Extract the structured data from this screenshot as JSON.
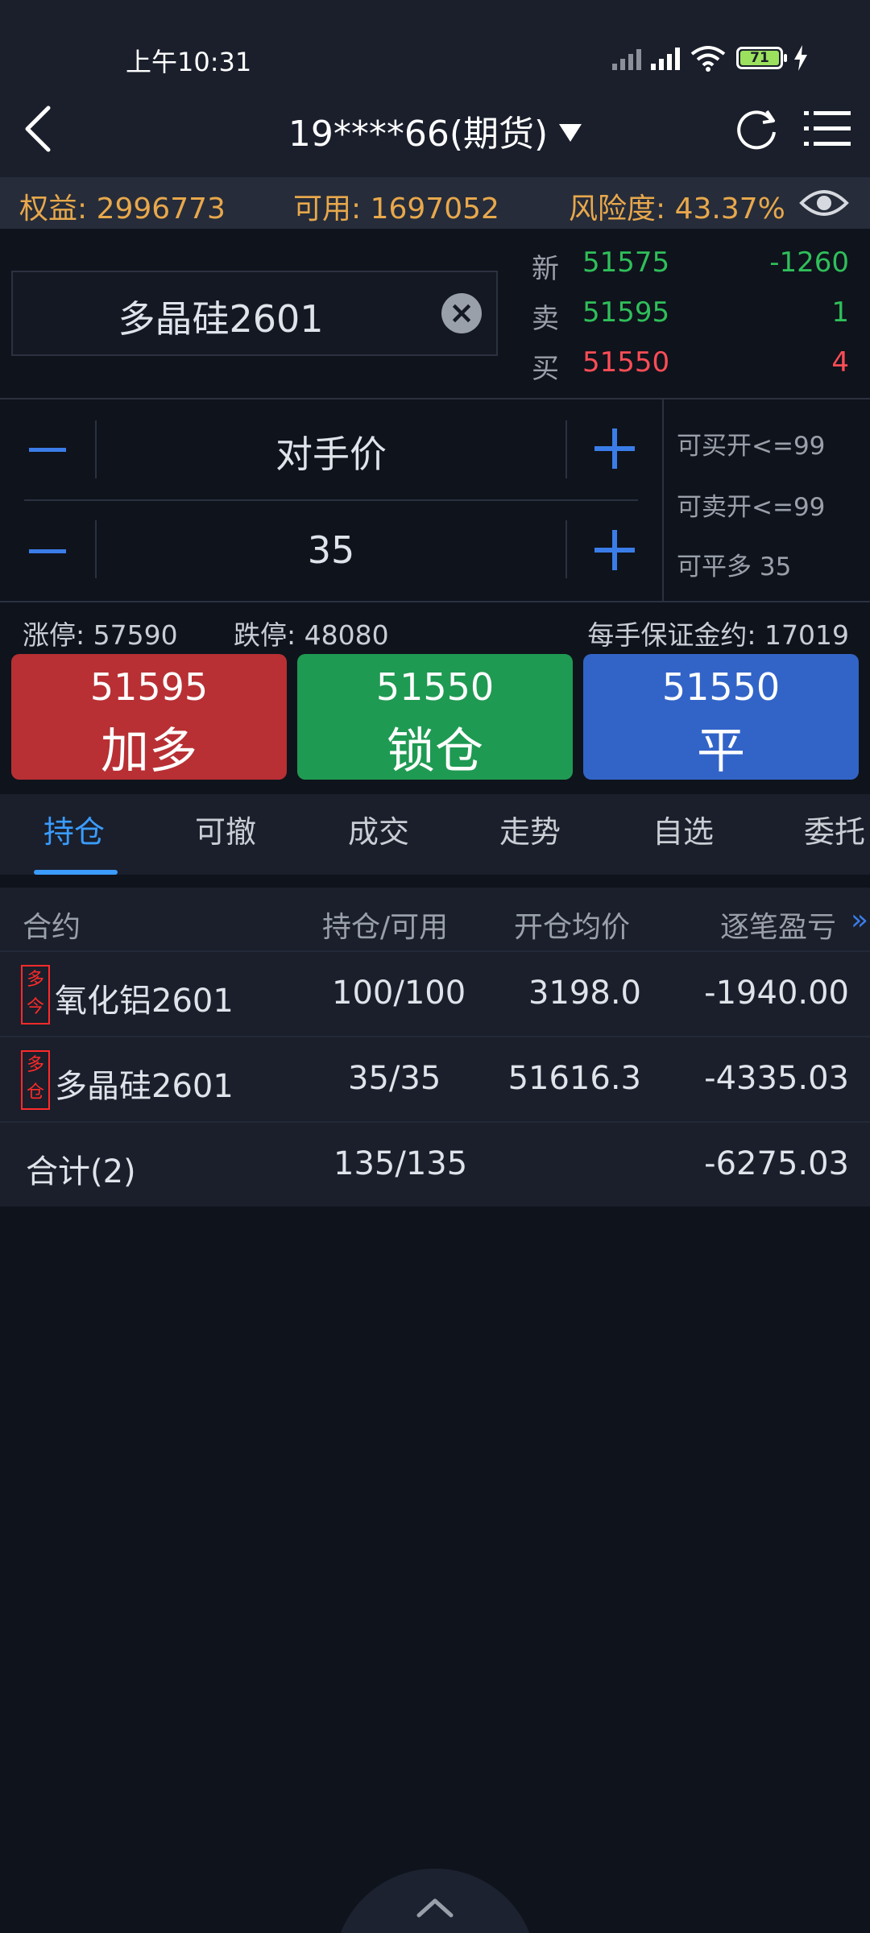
{
  "status_bar": {
    "time": "上午10:31",
    "battery": "71"
  },
  "header": {
    "account_title": "19****66(期货)"
  },
  "account_info": {
    "equity": "权益: 2996773",
    "available": "可用: 1697052",
    "risk": "风险度: 43.37%"
  },
  "contract": {
    "name": "多晶硅2601"
  },
  "quote": {
    "last": {
      "label": "新",
      "price": "51575",
      "change": "-1260"
    },
    "ask": {
      "label": "卖",
      "price": "51595",
      "volume": "1"
    },
    "bid": {
      "label": "买",
      "price": "51550",
      "volume": "4"
    }
  },
  "order": {
    "price_type": "对手价",
    "quantity": "35",
    "can_buy_open": "可买开<=99",
    "can_sell_open": "可卖开<=99",
    "can_close_long": "可平多 35"
  },
  "limits": {
    "limit_up": "涨停: 57590",
    "limit_down": "跌停: 48080",
    "margin": "每手保证金约: 17019"
  },
  "actions": [
    {
      "price": "51595",
      "label": "加多",
      "color": "#b83034"
    },
    {
      "price": "51550",
      "label": "锁仓",
      "color": "#1f9a52"
    },
    {
      "price": "51550",
      "label": "平",
      "color": "#3264c8"
    }
  ],
  "tabs": [
    "持仓",
    "可撤",
    "成交",
    "走势",
    "自选",
    "委托"
  ],
  "active_tab": "持仓",
  "positions": {
    "headers": [
      "合约",
      "持仓/可用",
      "开仓均价",
      "逐笔盈亏"
    ],
    "rows": [
      {
        "badge_top": "多",
        "badge_bottom": "今",
        "contract": "氧化铝2601",
        "qty": "100/100",
        "avg_price": "3198.0",
        "pnl": "-1940.00"
      },
      {
        "badge_top": "多",
        "badge_bottom": "仓",
        "contract": "多晶硅2601",
        "qty": "35/35",
        "avg_price": "51616.3",
        "pnl": "-4335.03"
      }
    ],
    "total": {
      "label": "合计(2)",
      "qty": "135/135",
      "pnl": "-6275.03"
    }
  },
  "colors": {
    "accent": "#3b9cff",
    "gain_down": "#2fbf5a",
    "gain_up": "#ff4d56",
    "info_orange": "#e8a84c"
  }
}
